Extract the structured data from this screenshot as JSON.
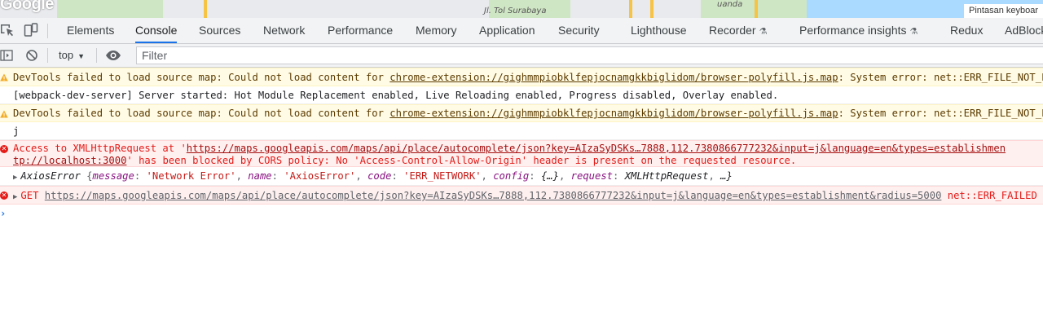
{
  "map": {
    "logo": "Google",
    "road_label": "Jl. Tol Surabaya",
    "place_label": "uanda",
    "keyboard_button": "Pintasan keyboar"
  },
  "tabs": [
    {
      "label": "Elements",
      "active": false
    },
    {
      "label": "Console",
      "active": true
    },
    {
      "label": "Sources",
      "active": false
    },
    {
      "label": "Network",
      "active": false
    },
    {
      "label": "Performance",
      "active": false
    },
    {
      "label": "Memory",
      "active": false
    },
    {
      "label": "Application",
      "active": false
    },
    {
      "label": "Security",
      "active": false
    },
    {
      "label": "Lighthouse",
      "active": false
    },
    {
      "label": "Recorder",
      "active": false
    },
    {
      "label": "Performance insights",
      "active": false
    },
    {
      "label": "Redux",
      "active": false
    },
    {
      "label": "AdBlock",
      "active": false
    }
  ],
  "toolbar": {
    "context": "top",
    "filter_placeholder": "Filter"
  },
  "messages": {
    "warn1": {
      "prefix": "DevTools failed to load source map: Could not load content for ",
      "link": "chrome-extension://gighmmpiobklfepjocnamgkkbiglidom/browser-polyfill.js.map",
      "suffix": ": System error: net::ERR_FILE_NOT_FOUND"
    },
    "log1": "[webpack-dev-server] Server started: Hot Module Replacement enabled, Live Reloading enabled, Progress disabled, Overlay enabled.",
    "warn2": {
      "prefix": "DevTools failed to load source map: Could not load content for ",
      "link": "chrome-extension://gighmmpiobklfepjocnamgkkbiglidom/browser-polyfill.js.map",
      "suffix": ": System error: net::ERR_FILE_NOT_FOUND"
    },
    "log2": "j",
    "err1": {
      "line1_prefix": "Access to XMLHttpRequest at '",
      "line1_link": "https://maps.googleapis.com/maps/api/place/autocomplete/json?key=AIzaSyDSKs…7888,112.7380866777232&input=j&language=en&types=establishmen",
      "line2_link": "tp://localhost:3000",
      "line2_suffix": "' has been blocked by CORS policy: No 'Access-Control-Allow-Origin' header is present on the requested resource."
    },
    "axios": {
      "name": "AxiosError",
      "message_key": "message",
      "message_val": "'Network Error'",
      "name_key": "name",
      "name_val": "'AxiosError'",
      "code_key": "code",
      "code_val": "'ERR_NETWORK'",
      "config_key": "config",
      "config_val": "{…}",
      "request_key": "request",
      "request_val": "XMLHttpRequest",
      "ellipsis": "…}"
    },
    "err2": {
      "method": "GET",
      "link": "https://maps.googleapis.com/maps/api/place/autocomplete/json?key=AIzaSyDSKs…7888,112.7380866777232&input=j&language=en&types=establishment&radius=5000",
      "suffix": "net::ERR_FAILED"
    }
  },
  "colors": {
    "accent": "#1a73e8",
    "warn_bg": "#fffbe5",
    "error_bg": "#fff0f0",
    "error_text": "#e41b17"
  }
}
